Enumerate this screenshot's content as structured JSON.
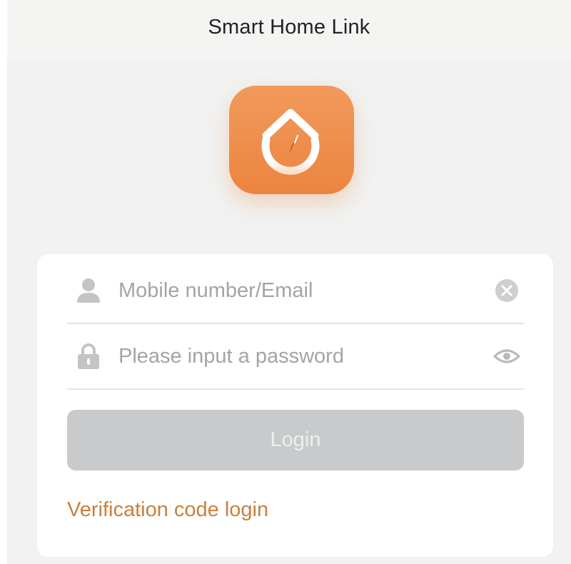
{
  "app": {
    "title": "Smart Home Link",
    "logo": "smart-home-logo",
    "brand_color": "#ec8440"
  },
  "login_form": {
    "account": {
      "icon": "user-icon",
      "placeholder": "Mobile number/Email",
      "value": "",
      "clear_icon": "clear-icon"
    },
    "password": {
      "icon": "lock-icon",
      "placeholder": "Please input a password",
      "value": "",
      "visibility_icon": "eye-icon"
    },
    "login_label": "Login",
    "login_enabled": false,
    "verification_link": "Verification code login",
    "link_color": "#c97f3e"
  }
}
